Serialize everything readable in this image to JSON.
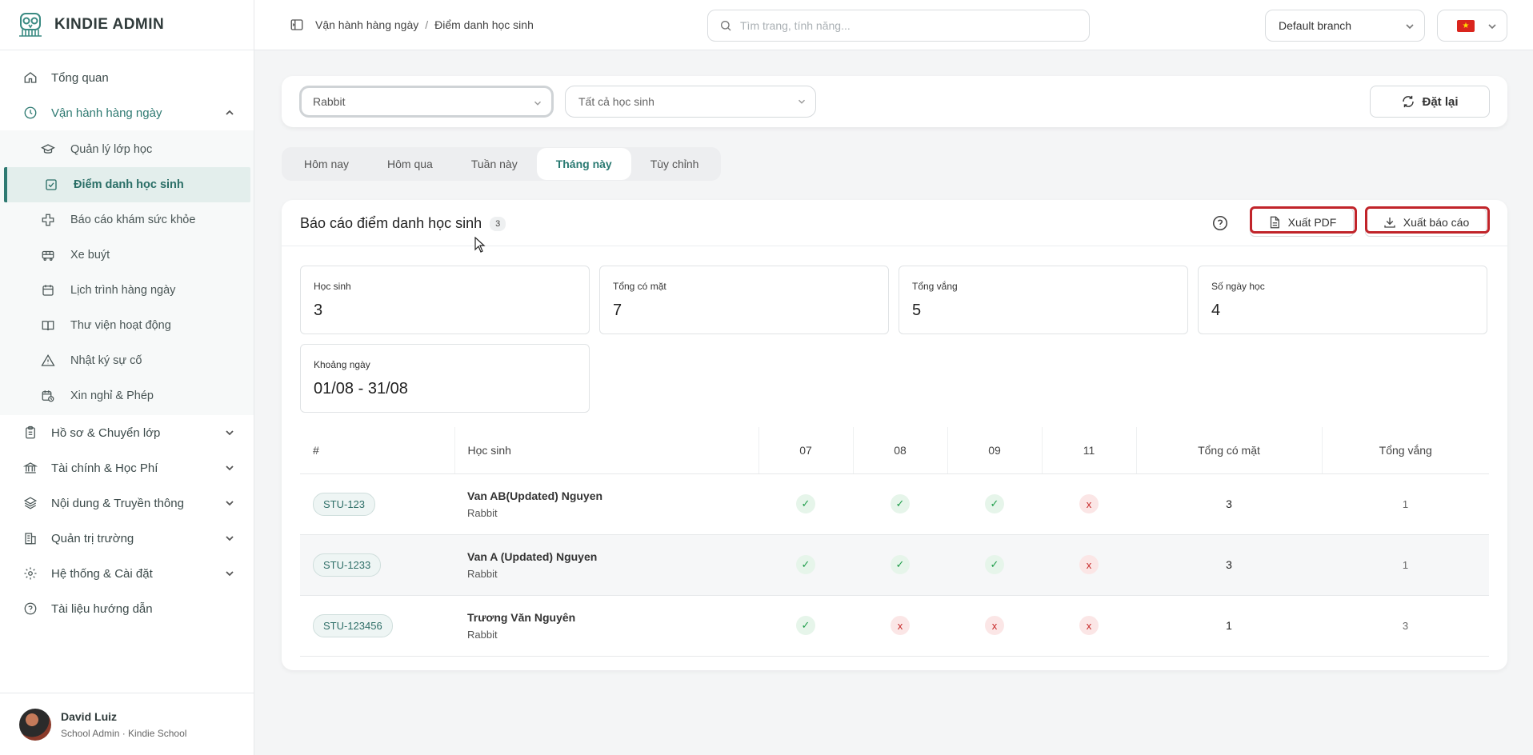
{
  "brand": {
    "name": "KINDIE ADMIN"
  },
  "sidebar": {
    "items": [
      {
        "label": "Tổng quan",
        "icon": "home-icon"
      },
      {
        "label": "Vận hành hàng ngày",
        "icon": "clock-icon",
        "open": true
      },
      {
        "label": "Hồ sơ & Chuyển lớp",
        "icon": "clipboard-icon"
      },
      {
        "label": "Tài chính & Học Phí",
        "icon": "bank-icon"
      },
      {
        "label": "Nội dung & Truyền thông",
        "icon": "layers-icon"
      },
      {
        "label": "Quản trị trường",
        "icon": "building-icon"
      },
      {
        "label": "Hệ thống & Cài đặt",
        "icon": "gear-icon"
      },
      {
        "label": "Tài liệu hướng dẫn",
        "icon": "help-circle-icon"
      }
    ],
    "sub_items": [
      {
        "label": "Quản lý lớp học",
        "icon": "graduation-cap-icon"
      },
      {
        "label": "Điểm danh học sinh",
        "icon": "check-square-icon",
        "active": true
      },
      {
        "label": "Báo cáo khám sức khỏe",
        "icon": "medical-cross-icon"
      },
      {
        "label": "Xe buýt",
        "icon": "bus-icon"
      },
      {
        "label": "Lịch trình hàng ngày",
        "icon": "calendar-icon"
      },
      {
        "label": "Thư viện hoạt động",
        "icon": "book-icon"
      },
      {
        "label": "Nhật ký sự cố",
        "icon": "warning-icon"
      },
      {
        "label": "Xin nghỉ & Phép",
        "icon": "calendar-clock-icon"
      }
    ]
  },
  "user": {
    "name": "David Luiz",
    "role": "School Admin · Kindie School"
  },
  "header": {
    "breadcrumb": [
      "Vận hành hàng ngày",
      "Điểm danh học sinh"
    ],
    "breadcrumb_sep": "/",
    "search_placeholder": "Tìm trang, tính năng...",
    "branch": "Default branch"
  },
  "filters": {
    "class_value": "Rabbit",
    "student_value": "Tất cả học sinh",
    "reset_label": "Đặt lại"
  },
  "tabs": [
    {
      "label": "Hôm nay"
    },
    {
      "label": "Hôm qua"
    },
    {
      "label": "Tuần này"
    },
    {
      "label": "Tháng này",
      "active": true
    },
    {
      "label": "Tùy chỉnh"
    }
  ],
  "report": {
    "title": "Báo cáo điểm danh học sinh",
    "count": "3",
    "export_pdf": "Xuất PDF",
    "export_report": "Xuất báo cáo",
    "stats": [
      {
        "label": "Học sinh",
        "value": "3"
      },
      {
        "label": "Tổng có mặt",
        "value": "7"
      },
      {
        "label": "Tổng vắng",
        "value": "5"
      },
      {
        "label": "Số ngày học",
        "value": "4"
      },
      {
        "label": "Khoảng ngày",
        "value": "01/08 - 31/08"
      }
    ],
    "columns": [
      "#",
      "Học sinh",
      "07",
      "08",
      "09",
      "11",
      "Tổng có mặt",
      "Tổng vắng"
    ],
    "present_mark": "✓",
    "absent_mark": "x",
    "rows": [
      {
        "id": "STU-123",
        "name": "Van AB(Updated) Nguyen",
        "class": "Rabbit",
        "marks": [
          "present",
          "present",
          "present",
          "absent"
        ],
        "present": "3",
        "absent": "1"
      },
      {
        "id": "STU-1233",
        "name": "Van A (Updated) Nguyen",
        "class": "Rabbit",
        "marks": [
          "present",
          "present",
          "present",
          "absent"
        ],
        "present": "3",
        "absent": "1"
      },
      {
        "id": "STU-123456",
        "name": "Trương Văn Nguyên",
        "class": "Rabbit",
        "marks": [
          "present",
          "absent",
          "absent",
          "absent"
        ],
        "present": "1",
        "absent": "3"
      }
    ]
  },
  "colors": {
    "accent": "#2f7a72",
    "highlight": "#c1242a",
    "present": "#1f9d4a",
    "absent": "#c62828"
  }
}
